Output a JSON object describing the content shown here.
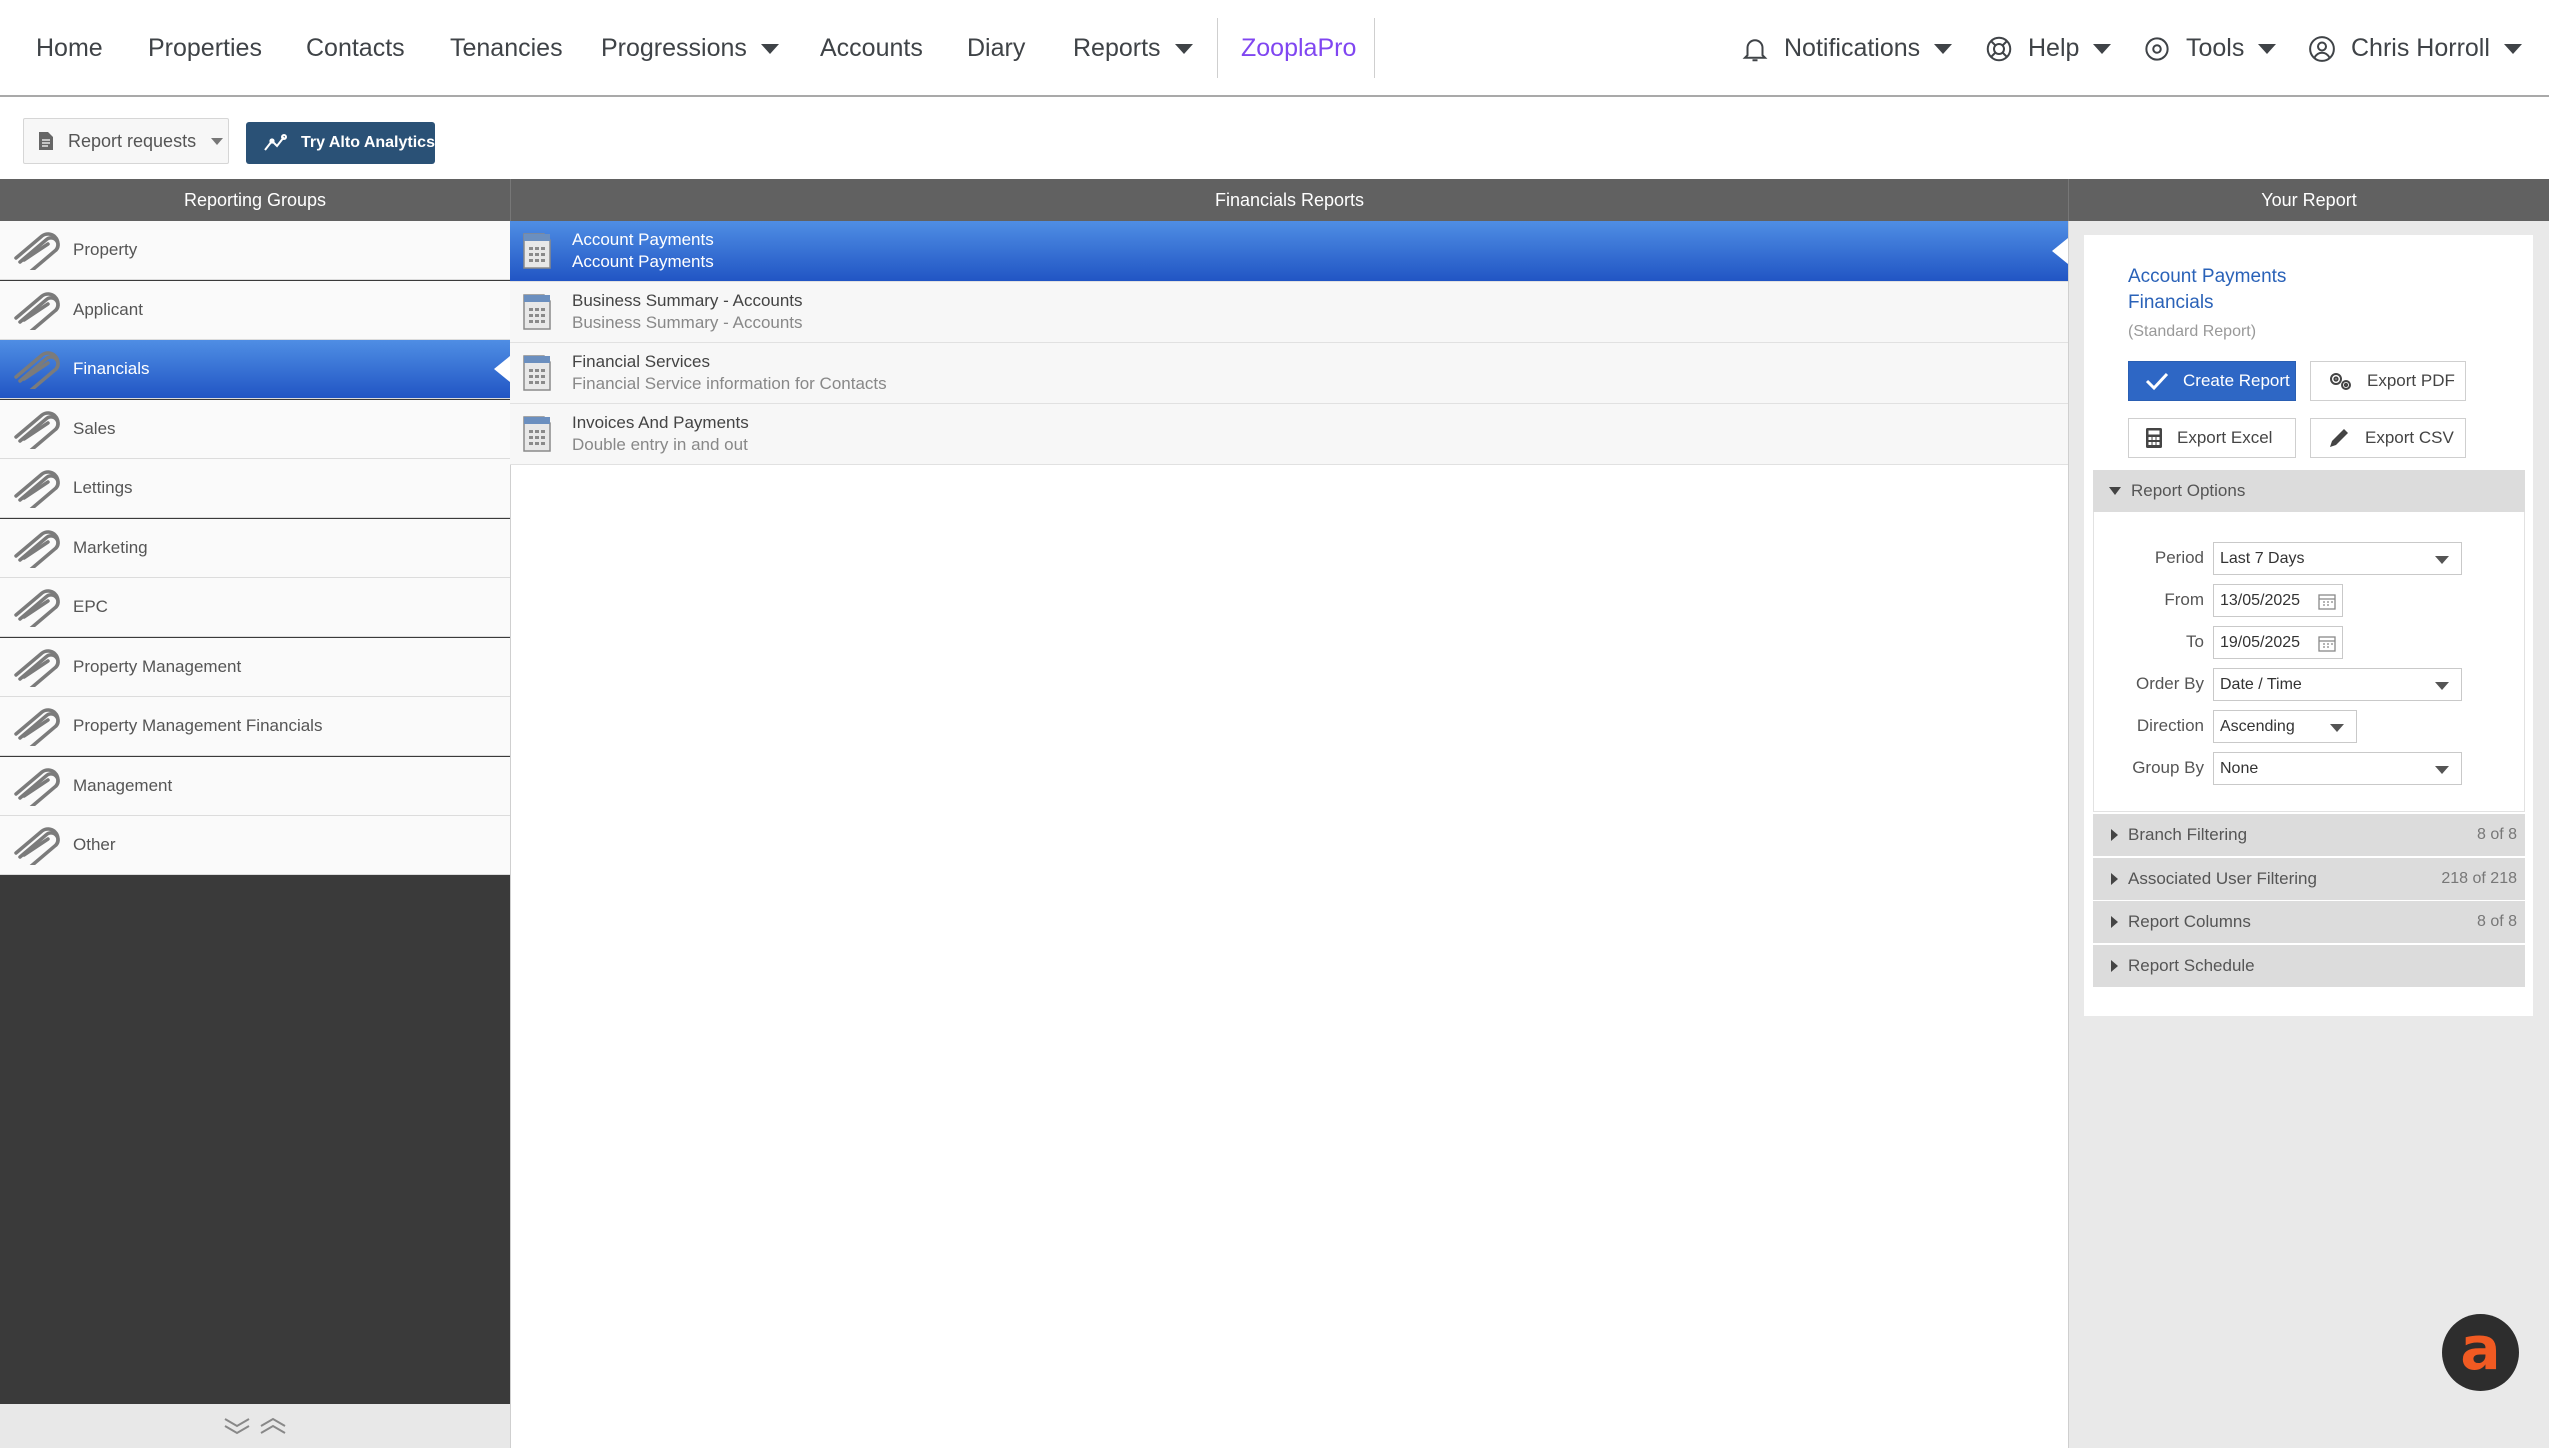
{
  "nav": {
    "home": "Home",
    "properties": "Properties",
    "contacts": "Contacts",
    "tenancies": "Tenancies",
    "progressions": "Progressions",
    "accounts": "Accounts",
    "diary": "Diary",
    "reports": "Reports",
    "zooplapro": "ZooplaPro",
    "notifications": "Notifications",
    "help": "Help",
    "tools": "Tools",
    "user": "Chris Horroll",
    "accent_color": "#8046f1"
  },
  "toolbar": {
    "report_requests": "Report requests",
    "try_analytics": "Try Alto Analytics"
  },
  "groups": {
    "header": "Reporting Groups",
    "items": [
      {
        "label": "Property"
      },
      {
        "label": "Applicant"
      },
      {
        "label": "Financials"
      },
      {
        "label": "Sales"
      },
      {
        "label": "Lettings"
      },
      {
        "label": "Marketing"
      },
      {
        "label": "EPC"
      },
      {
        "label": "Property Management"
      },
      {
        "label": "Property Management Financials"
      },
      {
        "label": "Management"
      },
      {
        "label": "Other"
      }
    ],
    "selected": "Financials"
  },
  "reports": {
    "header": "Financials Reports",
    "items": [
      {
        "title": "Account Payments",
        "desc": "Account Payments"
      },
      {
        "title": "Business Summary - Accounts",
        "desc": "Business Summary - Accounts"
      },
      {
        "title": "Financial Services",
        "desc": "Financial Service information for Contacts"
      },
      {
        "title": "Invoices And Payments",
        "desc": "Double entry in and out"
      }
    ],
    "selected": "Account Payments"
  },
  "your_report": {
    "header": "Your Report",
    "name": "Account Payments",
    "group": "Financials",
    "type": "(Standard Report)",
    "create": "Create Report",
    "export_pdf": "Export PDF",
    "export_excel": "Export Excel",
    "export_csv": "Export CSV",
    "options": {
      "title": "Report Options",
      "period_label": "Period",
      "period_value": "Last 7 Days",
      "from_label": "From",
      "from_value": "13/05/2025",
      "to_label": "To",
      "to_value": "19/05/2025",
      "order_label": "Order By",
      "order_value": "Date / Time",
      "direction_label": "Direction",
      "direction_value": "Ascending",
      "group_label": "Group By",
      "group_value": "None"
    },
    "sections": [
      {
        "label": "Branch Filtering",
        "count": "8 of 8"
      },
      {
        "label": "Associated User Filtering",
        "count": "218 of 218"
      },
      {
        "label": "Report Columns",
        "count": "8 of 8"
      },
      {
        "label": "Report Schedule",
        "count": ""
      }
    ],
    "primary_color": "#2e67c5"
  },
  "fab": {
    "letter": "a",
    "color": "#f05a22"
  }
}
